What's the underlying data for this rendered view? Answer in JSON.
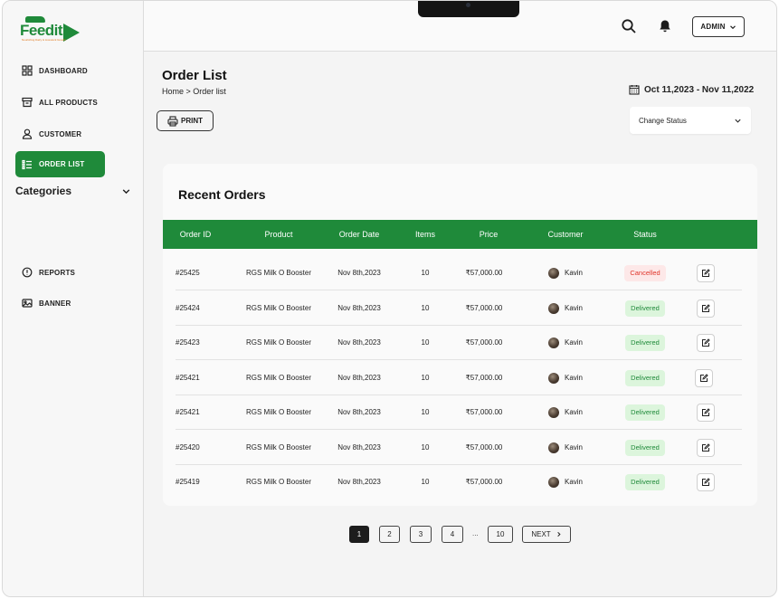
{
  "logo": {
    "word": "Feedit",
    "tagline": "Nourishing Dairy & Livestock Growth"
  },
  "sidebar": {
    "items": [
      {
        "label": "DASHBOARD",
        "icon": "dashboard-icon"
      },
      {
        "label": "ALL PRODUCTS",
        "icon": "box-icon"
      },
      {
        "label": "CUSTOMER",
        "icon": "user-icon"
      },
      {
        "label": "ORDER LIST",
        "icon": "list-icon",
        "active": true
      }
    ],
    "categories_label": "Categories",
    "bottom_items": [
      {
        "label": "REPORTS",
        "icon": "alert-circle-icon"
      },
      {
        "label": "BANNER",
        "icon": "image-icon"
      }
    ]
  },
  "header": {
    "admin_label": "ADMIN"
  },
  "page": {
    "title": "Order List",
    "breadcrumb": "Home > Order list",
    "date_range": "Oct 11,2023 - Nov 11,2022",
    "print_label": "PRINT",
    "status_select": "Change Status"
  },
  "orders": {
    "title": "Recent Orders",
    "columns": [
      "Order ID",
      "Product",
      "Order Date",
      "Items",
      "Price",
      "Customer",
      "Status"
    ],
    "rows": [
      {
        "id": "#25425",
        "product": "RGS Milk O Booster",
        "date": "Nov 8th,2023",
        "items": "10",
        "price": "₹57,000.00",
        "customer": "Kavin",
        "status": "Cancelled"
      },
      {
        "id": "#25424",
        "product": "RGS Milk O Booster",
        "date": "Nov 8th,2023",
        "items": "10",
        "price": "₹57,000.00",
        "customer": "Kavin",
        "status": "Delivered"
      },
      {
        "id": "#25423",
        "product": "RGS Milk O Booster",
        "date": "Nov 8th,2023",
        "items": "10",
        "price": "₹57,000.00",
        "customer": "Kavin",
        "status": "Delivered"
      },
      {
        "id": "#25421",
        "product": "RGS Milk O Booster",
        "date": "Nov 8th,2023",
        "items": "10",
        "price": "₹57,000.00",
        "customer": "Kavin",
        "status": "Delivered"
      },
      {
        "id": "#25421",
        "product": "RGS Milk O Booster",
        "date": "Nov 8th,2023",
        "items": "10",
        "price": "₹57,000.00",
        "customer": "Kavin",
        "status": "Delivered"
      },
      {
        "id": "#25420",
        "product": "RGS Milk O Booster",
        "date": "Nov 8th,2023",
        "items": "10",
        "price": "₹57,000.00",
        "customer": "Kavin",
        "status": "Delivered"
      },
      {
        "id": "#25419",
        "product": "RGS Milk O Booster",
        "date": "Nov 8th,2023",
        "items": "10",
        "price": "₹57,000.00",
        "customer": "Kavin",
        "status": "Delivered"
      }
    ]
  },
  "pagination": {
    "pages": [
      "1",
      "2",
      "3",
      "4",
      "10"
    ],
    "ellipsis": "...",
    "next_label": "NEXT",
    "current": "1"
  },
  "colors": {
    "brand_green": "#1f8a3a",
    "cancelled_red": "#e0352b"
  }
}
